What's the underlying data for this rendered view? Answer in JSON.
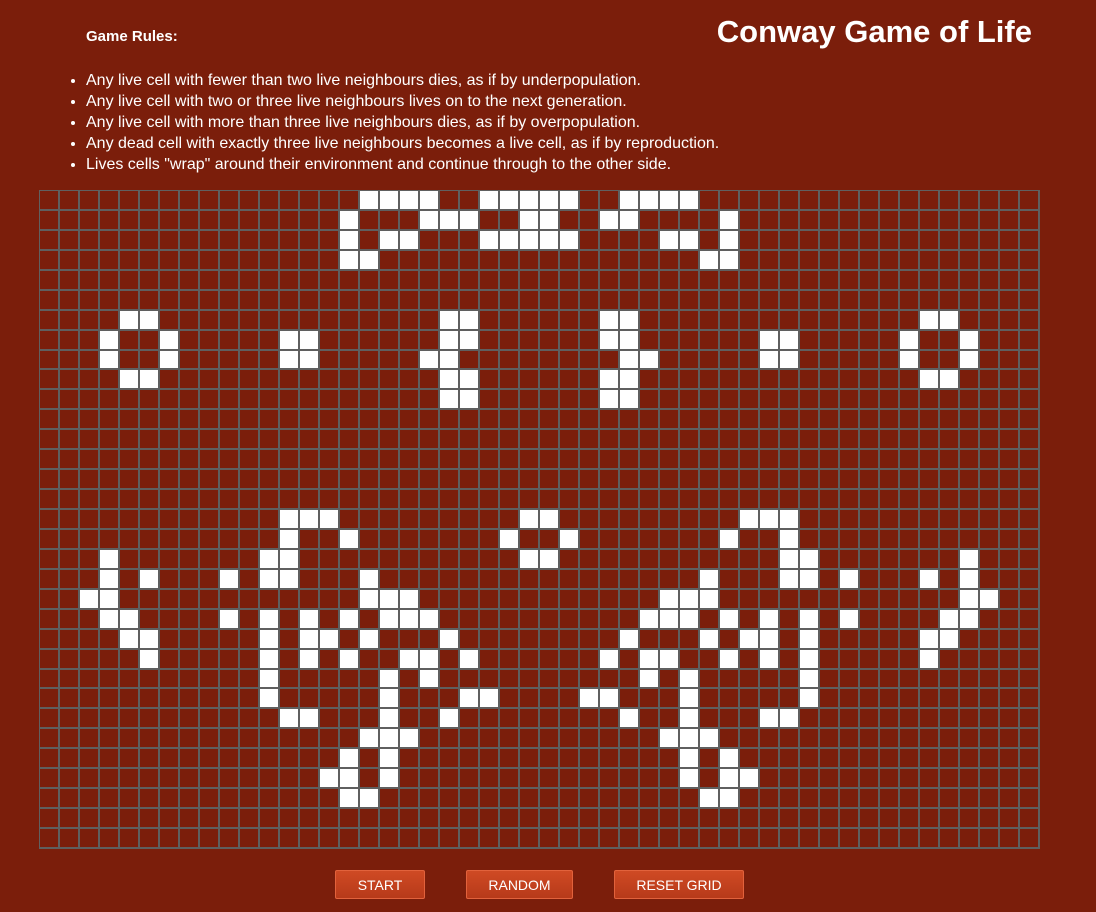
{
  "page": {
    "title": "Conway Game of Life",
    "rules_heading": "Game Rules:",
    "rules": [
      "Any live cell with fewer than two live neighbours dies, as if by underpopulation.",
      "Any live cell with two or three live neighbours lives on to the next generation.",
      "Any live cell with more than three live neighbours dies, as if by overpopulation.",
      "Any dead cell with exactly three live neighbours becomes a live cell, as if by reproduction.",
      "Lives cells \"wrap\" around their environment and continue through to the other side."
    ]
  },
  "grid": {
    "columns": 50,
    "rows": 33,
    "colors": {
      "background": "#7b1e0b",
      "alive": "#ffffff",
      "lines": "#5f5f5f"
    },
    "alive_cells": [
      [
        0,
        16
      ],
      [
        0,
        17
      ],
      [
        0,
        18
      ],
      [
        0,
        19
      ],
      [
        0,
        22
      ],
      [
        0,
        23
      ],
      [
        0,
        24
      ],
      [
        0,
        25
      ],
      [
        0,
        26
      ],
      [
        0,
        29
      ],
      [
        0,
        30
      ],
      [
        0,
        31
      ],
      [
        0,
        32
      ],
      [
        1,
        15
      ],
      [
        1,
        19
      ],
      [
        1,
        20
      ],
      [
        1,
        21
      ],
      [
        1,
        24
      ],
      [
        1,
        25
      ],
      [
        1,
        28
      ],
      [
        1,
        29
      ],
      [
        1,
        34
      ],
      [
        2,
        15
      ],
      [
        2,
        17
      ],
      [
        2,
        18
      ],
      [
        2,
        22
      ],
      [
        2,
        23
      ],
      [
        2,
        24
      ],
      [
        2,
        25
      ],
      [
        2,
        26
      ],
      [
        2,
        31
      ],
      [
        2,
        32
      ],
      [
        2,
        34
      ],
      [
        3,
        15
      ],
      [
        3,
        16
      ],
      [
        3,
        33
      ],
      [
        3,
        34
      ],
      [
        6,
        4
      ],
      [
        6,
        5
      ],
      [
        6,
        20
      ],
      [
        6,
        21
      ],
      [
        6,
        28
      ],
      [
        6,
        29
      ],
      [
        6,
        44
      ],
      [
        6,
        45
      ],
      [
        7,
        3
      ],
      [
        7,
        6
      ],
      [
        7,
        12
      ],
      [
        7,
        13
      ],
      [
        7,
        20
      ],
      [
        7,
        21
      ],
      [
        7,
        28
      ],
      [
        7,
        29
      ],
      [
        7,
        36
      ],
      [
        7,
        37
      ],
      [
        7,
        43
      ],
      [
        7,
        46
      ],
      [
        8,
        3
      ],
      [
        8,
        6
      ],
      [
        8,
        12
      ],
      [
        8,
        13
      ],
      [
        8,
        19
      ],
      [
        8,
        20
      ],
      [
        8,
        29
      ],
      [
        8,
        30
      ],
      [
        8,
        36
      ],
      [
        8,
        37
      ],
      [
        8,
        43
      ],
      [
        8,
        46
      ],
      [
        9,
        4
      ],
      [
        9,
        5
      ],
      [
        9,
        20
      ],
      [
        9,
        21
      ],
      [
        9,
        28
      ],
      [
        9,
        29
      ],
      [
        9,
        44
      ],
      [
        9,
        45
      ],
      [
        10,
        20
      ],
      [
        10,
        21
      ],
      [
        10,
        28
      ],
      [
        10,
        29
      ],
      [
        16,
        12
      ],
      [
        16,
        13
      ],
      [
        16,
        14
      ],
      [
        16,
        24
      ],
      [
        16,
        25
      ],
      [
        16,
        35
      ],
      [
        16,
        36
      ],
      [
        16,
        37
      ],
      [
        17,
        12
      ],
      [
        17,
        15
      ],
      [
        17,
        23
      ],
      [
        17,
        26
      ],
      [
        17,
        34
      ],
      [
        17,
        37
      ],
      [
        18,
        3
      ],
      [
        18,
        11
      ],
      [
        18,
        12
      ],
      [
        18,
        24
      ],
      [
        18,
        25
      ],
      [
        18,
        37
      ],
      [
        18,
        38
      ],
      [
        18,
        46
      ],
      [
        19,
        3
      ],
      [
        19,
        5
      ],
      [
        19,
        9
      ],
      [
        19,
        11
      ],
      [
        19,
        12
      ],
      [
        19,
        16
      ],
      [
        19,
        33
      ],
      [
        19,
        37
      ],
      [
        19,
        38
      ],
      [
        19,
        40
      ],
      [
        19,
        44
      ],
      [
        19,
        46
      ],
      [
        20,
        2
      ],
      [
        20,
        3
      ],
      [
        20,
        16
      ],
      [
        20,
        17
      ],
      [
        20,
        18
      ],
      [
        20,
        31
      ],
      [
        20,
        32
      ],
      [
        20,
        33
      ],
      [
        20,
        46
      ],
      [
        20,
        47
      ],
      [
        21,
        3
      ],
      [
        21,
        4
      ],
      [
        21,
        9
      ],
      [
        21,
        11
      ],
      [
        21,
        13
      ],
      [
        21,
        15
      ],
      [
        21,
        17
      ],
      [
        21,
        18
      ],
      [
        21,
        19
      ],
      [
        21,
        30
      ],
      [
        21,
        31
      ],
      [
        21,
        32
      ],
      [
        21,
        34
      ],
      [
        21,
        36
      ],
      [
        21,
        38
      ],
      [
        21,
        40
      ],
      [
        21,
        45
      ],
      [
        21,
        46
      ],
      [
        22,
        4
      ],
      [
        22,
        5
      ],
      [
        22,
        11
      ],
      [
        22,
        13
      ],
      [
        22,
        14
      ],
      [
        22,
        16
      ],
      [
        22,
        20
      ],
      [
        22,
        29
      ],
      [
        22,
        33
      ],
      [
        22,
        35
      ],
      [
        22,
        36
      ],
      [
        22,
        38
      ],
      [
        22,
        44
      ],
      [
        22,
        45
      ],
      [
        23,
        5
      ],
      [
        23,
        11
      ],
      [
        23,
        13
      ],
      [
        23,
        15
      ],
      [
        23,
        18
      ],
      [
        23,
        19
      ],
      [
        23,
        21
      ],
      [
        23,
        28
      ],
      [
        23,
        30
      ],
      [
        23,
        31
      ],
      [
        23,
        34
      ],
      [
        23,
        36
      ],
      [
        23,
        38
      ],
      [
        23,
        44
      ],
      [
        24,
        11
      ],
      [
        24,
        17
      ],
      [
        24,
        19
      ],
      [
        24,
        30
      ],
      [
        24,
        32
      ],
      [
        24,
        38
      ],
      [
        25,
        11
      ],
      [
        25,
        17
      ],
      [
        25,
        21
      ],
      [
        25,
        22
      ],
      [
        25,
        27
      ],
      [
        25,
        28
      ],
      [
        25,
        32
      ],
      [
        25,
        38
      ],
      [
        26,
        12
      ],
      [
        26,
        13
      ],
      [
        26,
        17
      ],
      [
        26,
        20
      ],
      [
        26,
        29
      ],
      [
        26,
        32
      ],
      [
        26,
        36
      ],
      [
        26,
        37
      ],
      [
        27,
        16
      ],
      [
        27,
        17
      ],
      [
        27,
        18
      ],
      [
        27,
        31
      ],
      [
        27,
        32
      ],
      [
        27,
        33
      ],
      [
        28,
        15
      ],
      [
        28,
        17
      ],
      [
        28,
        32
      ],
      [
        28,
        34
      ],
      [
        29,
        14
      ],
      [
        29,
        15
      ],
      [
        29,
        17
      ],
      [
        29,
        32
      ],
      [
        29,
        34
      ],
      [
        29,
        35
      ],
      [
        30,
        15
      ],
      [
        30,
        16
      ],
      [
        30,
        33
      ],
      [
        30,
        34
      ]
    ]
  },
  "controls": {
    "start_label": "START",
    "random_label": "RANDOM",
    "reset_label": "RESET GRID"
  }
}
